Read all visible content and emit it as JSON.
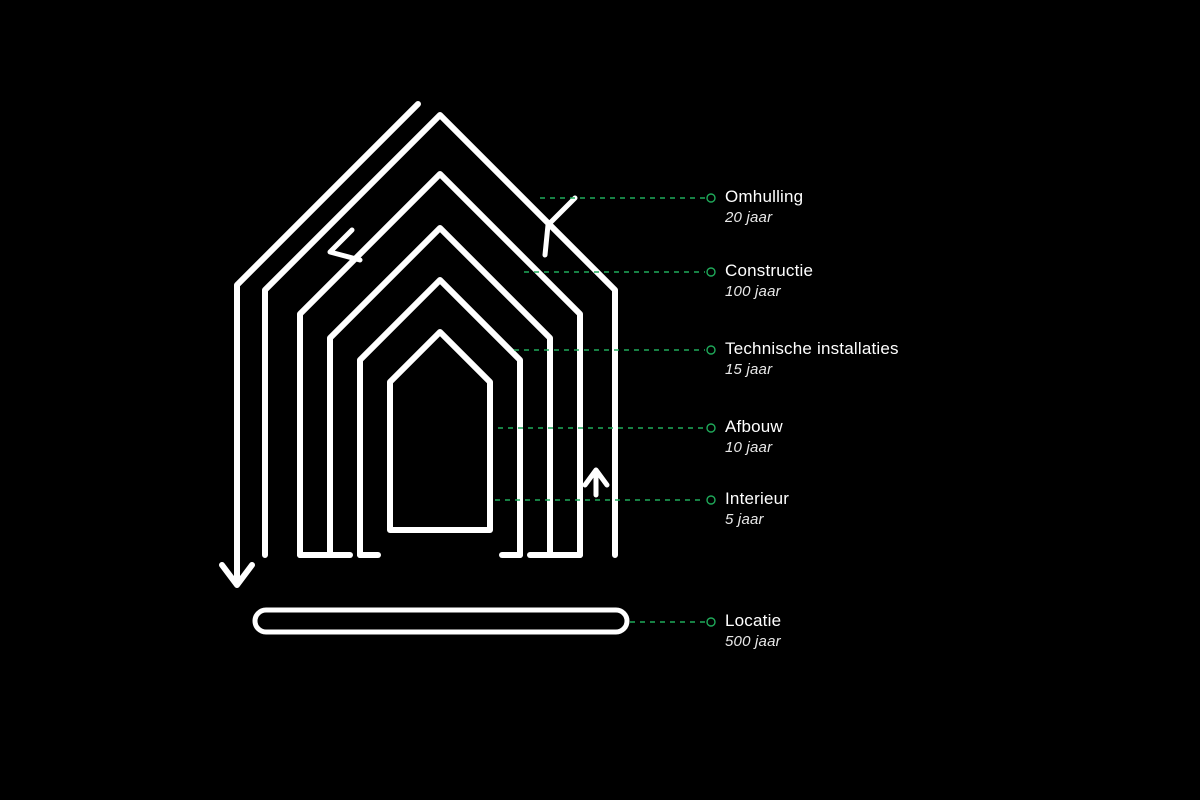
{
  "diagram": {
    "type": "shearing-layers",
    "layers": [
      {
        "id": "omhulling",
        "title": "Omhulling",
        "subtitle": "20 jaar"
      },
      {
        "id": "constructie",
        "title": "Constructie",
        "subtitle": "100 jaar"
      },
      {
        "id": "technisch",
        "title": "Technische installaties",
        "subtitle": "15 jaar"
      },
      {
        "id": "afbouw",
        "title": "Afbouw",
        "subtitle": "10 jaar"
      },
      {
        "id": "interieur",
        "title": "Interieur",
        "subtitle": "5 jaar"
      },
      {
        "id": "locatie",
        "title": "Locatie",
        "subtitle": "500 jaar"
      }
    ],
    "colors": {
      "line": "#ffffff",
      "leader": "#1faa5a"
    }
  }
}
